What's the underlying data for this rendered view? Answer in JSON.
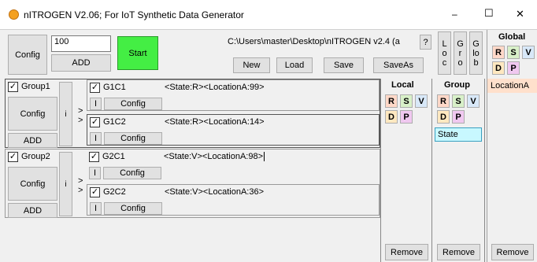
{
  "window": {
    "title": "nITROGEN V2.06; For IoT Synthetic Data Generator",
    "minimize": "–",
    "maximize": "☐",
    "close": "✕"
  },
  "toolbar": {
    "config": "Config",
    "count_value": "100",
    "add": "ADD",
    "start": "Start",
    "path": "C:\\Users\\master\\Desktop\\nITROGEN v2.4 (a",
    "help": "?",
    "new": "New",
    "load": "Load",
    "save": "Save",
    "saveas": "SaveAs"
  },
  "view_buttons": {
    "local": "L\no\nc",
    "group": "G\nr\no",
    "global": "G\nlo\nb"
  },
  "groups": [
    {
      "name": "Group1",
      "config": "Config",
      "i": "i",
      "add": "ADD",
      "arrow": ">",
      "children": [
        {
          "name": "G1C1",
          "text": "<State:R><LocationA:99>",
          "i": "I",
          "config": "Config"
        },
        {
          "name": "G1C2",
          "text": "<State:R><LocationA:14>",
          "i": "I",
          "config": "Config"
        }
      ]
    },
    {
      "name": "Group2",
      "config": "Config",
      "i": "i",
      "add": "ADD",
      "arrow": ">",
      "children": [
        {
          "name": "G2C1",
          "text": "<State:V><LocationA:98>",
          "i": "I",
          "config": "Config"
        },
        {
          "name": "G2C2",
          "text": "<State:V><LocationA:36>",
          "i": "I",
          "config": "Config"
        }
      ]
    }
  ],
  "panels": {
    "local": {
      "title": "Local",
      "remove": "Remove"
    },
    "group": {
      "title": "Group",
      "item": "State",
      "remove": "Remove"
    },
    "global": {
      "title": "Global",
      "item": "LocationA",
      "remove": "Remove"
    },
    "flags": {
      "r": "R",
      "s": "S",
      "v": "V",
      "d": "D",
      "p": "P"
    }
  },
  "colors": {
    "start": "#44ee44",
    "state_item": "#c8f8ff",
    "location_item": "#ffe0cc"
  }
}
